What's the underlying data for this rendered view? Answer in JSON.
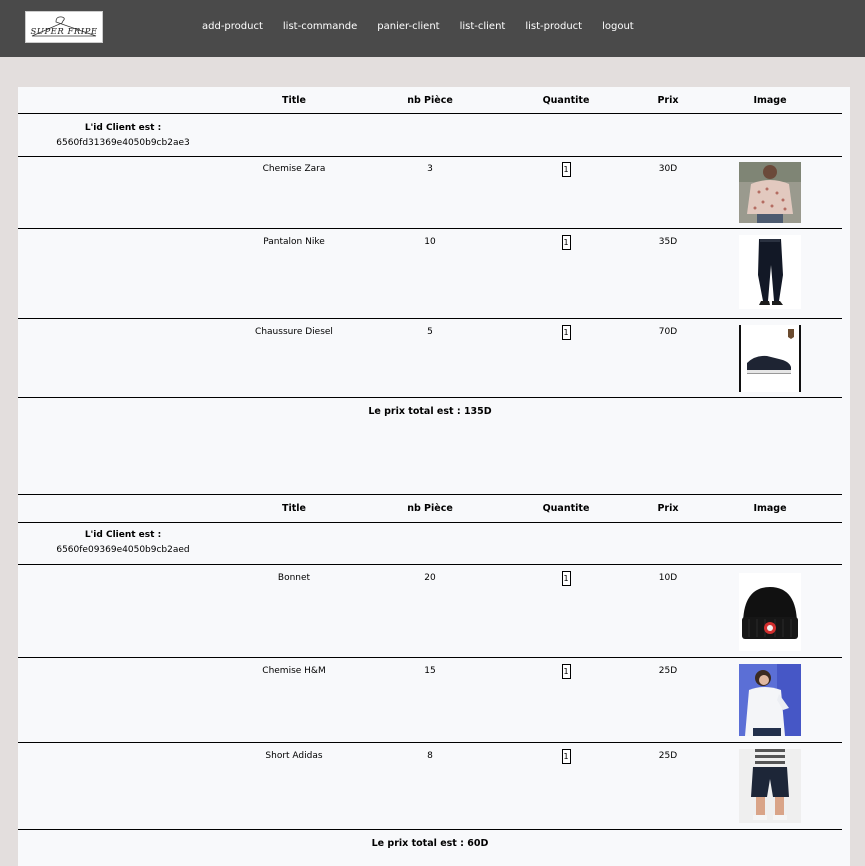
{
  "nav": {
    "brand": "SUPER FRIPE",
    "links": [
      "add-product",
      "list-commande",
      "panier-client",
      "list-client",
      "list-product",
      "logout"
    ]
  },
  "headers": {
    "title": "Title",
    "nb": "nb Pièce",
    "qty": "Quantite",
    "prix": "Prix",
    "image": "Image"
  },
  "carts": [
    {
      "client_label": "L'id Client est :",
      "client_id": "6560fd31369e4050b9cb2ae3",
      "items": [
        {
          "title": "Chemise Zara",
          "nb": "3",
          "qty": "1",
          "prix": "30D",
          "image": "sweater-photo"
        },
        {
          "title": "Pantalon Nike",
          "nb": "10",
          "qty": "1",
          "prix": "35D",
          "image": "pants-photo"
        },
        {
          "title": "Chaussure Diesel",
          "nb": "5",
          "qty": "1",
          "prix": "70D",
          "image": "shoe-photo"
        }
      ],
      "total": "Le prix total est : 135D"
    },
    {
      "client_label": "L'id Client est :",
      "client_id": "6560fe09369e4050b9cb2aed",
      "items": [
        {
          "title": "Bonnet",
          "nb": "20",
          "qty": "1",
          "prix": "10D",
          "image": "beanie-photo"
        },
        {
          "title": "Chemise H&M",
          "nb": "15",
          "qty": "1",
          "prix": "25D",
          "image": "shirt-photo"
        },
        {
          "title": "Short Adidas",
          "nb": "8",
          "qty": "1",
          "prix": "25D",
          "image": "shorts-photo"
        }
      ],
      "total": "Le prix total est : 60D"
    }
  ]
}
